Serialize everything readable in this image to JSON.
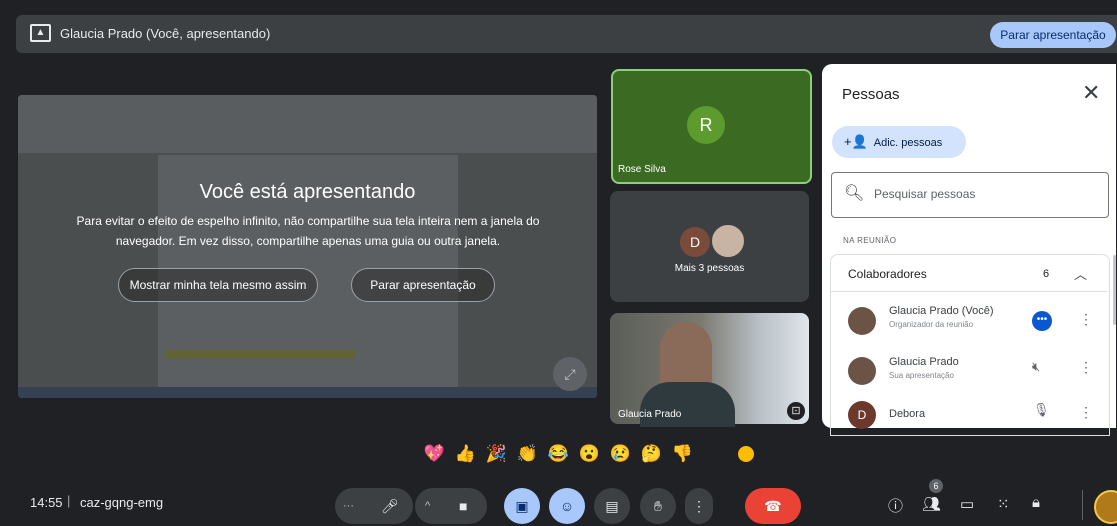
{
  "top_bar": {
    "presenter_label": "Glaucia Prado (Você, apresentando)",
    "stop_presenting": "Parar apresentação"
  },
  "presentation": {
    "title": "Você está apresentando",
    "message": "Para evitar o efeito de espelho infinito, não compartilhe sua tela inteira nem a janela do navegador. Em vez disso, compartilhe apenas uma guia ou outra janela.",
    "show_anyway": "Mostrar minha tela mesmo assim",
    "stop_presenting": "Parar apresentação"
  },
  "tiles": {
    "rose": {
      "initial": "R",
      "name": "Rose Silva"
    },
    "more": {
      "initial": "D",
      "label": "Mais 3 pessoas"
    },
    "self": {
      "name": "Glaucia Prado"
    }
  },
  "people_panel": {
    "title": "Pessoas",
    "add_people": "Adic. pessoas",
    "search_placeholder": "Pesquisar pessoas",
    "in_meeting_label": "NA REUNIÃO",
    "group": {
      "label": "Colaboradores",
      "count": "6"
    },
    "participants": [
      {
        "name": "Glaucia Prado (Você)",
        "subtitle": "Organizador da reunião"
      },
      {
        "name": "Glaucia Prado",
        "subtitle": "Sua apresentação"
      },
      {
        "name": "Debora",
        "subtitle": "",
        "initial": "D"
      }
    ]
  },
  "reactions": [
    "💖",
    "👍",
    "🎉",
    "👏",
    "😂",
    "😮",
    "😢",
    "🤔",
    "👎"
  ],
  "bottom_bar": {
    "time": "14:55",
    "separator": "|",
    "meeting_code": "caz-gqng-emg",
    "participant_count": "6"
  },
  "colors": {
    "background": "#202124",
    "accent": "#a8c7fa",
    "leave": "#ea4335",
    "active_speaker": "#8dd07a"
  },
  "icons": [
    "present-to-all-icon",
    "close-icon",
    "add-person-icon",
    "search-icon",
    "more-horiz-icon",
    "mic-icon",
    "videocam-icon",
    "present-icon",
    "emoji-icon",
    "captions-icon",
    "raise-hand-icon",
    "more-vert-icon",
    "call-end-icon",
    "info-icon",
    "people-icon",
    "chat-icon",
    "activities-icon",
    "host-controls-icon"
  ]
}
